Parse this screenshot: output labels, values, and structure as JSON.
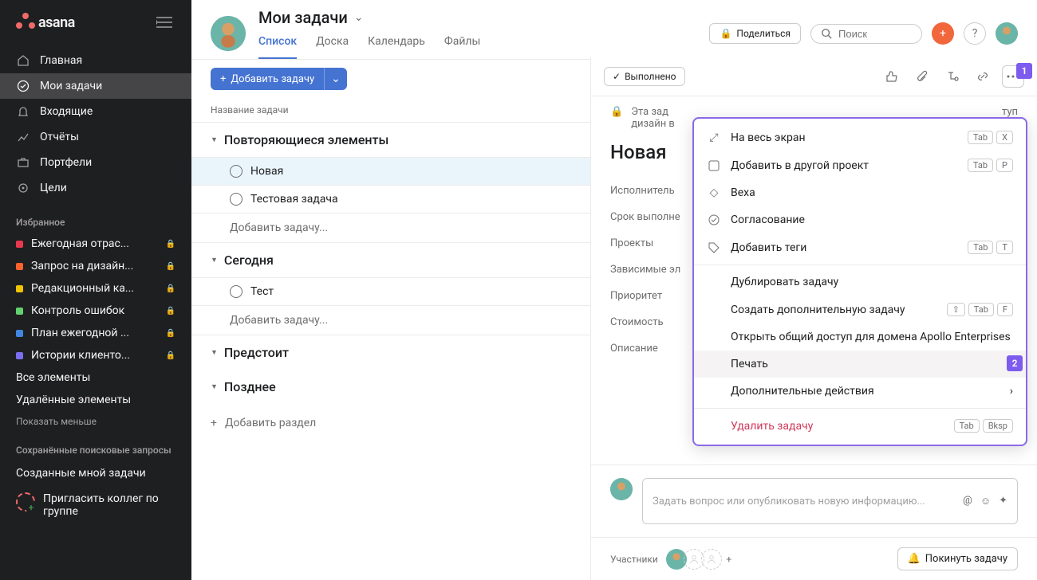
{
  "brand": "asana",
  "sidebar": {
    "nav": [
      {
        "label": "Главная",
        "name": "nav-home"
      },
      {
        "label": "Мои задачи",
        "name": "nav-my-tasks",
        "active": true
      },
      {
        "label": "Входящие",
        "name": "nav-inbox"
      },
      {
        "label": "Отчёты",
        "name": "nav-reports"
      },
      {
        "label": "Портфели",
        "name": "nav-portfolios"
      },
      {
        "label": "Цели",
        "name": "nav-goals"
      }
    ],
    "favorites_head": "Избранное",
    "favorites": [
      {
        "label": "Ежегодная отрас...",
        "color": "#e8384f",
        "locked": true
      },
      {
        "label": "Запрос на дизайн...",
        "color": "#fd612c",
        "locked": true
      },
      {
        "label": "Редакционный ка...",
        "color": "#eec300",
        "locked": true
      },
      {
        "label": "Контроль ошибок",
        "color": "#62d26f",
        "locked": true
      },
      {
        "label": "План ежегодной ...",
        "color": "#4186e0",
        "locked": true
      },
      {
        "label": "Истории клиенто...",
        "color": "#7a6ff0",
        "locked": true
      }
    ],
    "all_items": "Все элементы",
    "deleted_items": "Удалённые элементы",
    "show_less": "Показать меньше",
    "saved_head": "Сохранённые поисковые запросы",
    "created_by_me": "Созданные мной задачи",
    "invite": "Пригласить коллег по группе"
  },
  "header": {
    "title": "Мои задачи",
    "tabs": [
      {
        "label": "Список",
        "active": true
      },
      {
        "label": "Доска"
      },
      {
        "label": "Календарь"
      },
      {
        "label": "Файлы"
      }
    ],
    "share": "Поделиться",
    "search_placeholder": "Поиск"
  },
  "toolbar": {
    "add_task": "Добавить задачу"
  },
  "list": {
    "column_head": "Название задачи",
    "sections": [
      {
        "title": "Повторяющиеся элементы",
        "tasks": [
          {
            "label": "Новая",
            "selected": true
          },
          {
            "label": "Тестовая задача"
          }
        ],
        "add": "Добавить задачу..."
      },
      {
        "title": "Сегодня",
        "tasks": [
          {
            "label": "Тест"
          }
        ],
        "add": "Добавить задачу..."
      },
      {
        "title": "Предстоит",
        "tasks": []
      },
      {
        "title": "Позднее",
        "tasks": []
      }
    ],
    "add_section": "Добавить раздел"
  },
  "detail": {
    "done": "Выполнено",
    "privacy_line1": "Эта зад",
    "privacy_line2": "дизайн в",
    "privacy_tail": "туп",
    "title": "Новая",
    "fields": [
      {
        "label": "Исполнитель"
      },
      {
        "label": "Срок выполне"
      },
      {
        "label": "Проекты"
      },
      {
        "label": "Зависимые эл"
      },
      {
        "label": "Приоритет"
      },
      {
        "label": "Стоимость"
      },
      {
        "label": "Описание"
      }
    ],
    "comment_placeholder": "Задать вопрос или опубликовать новую информацию...",
    "followers_label": "Участники",
    "leave": "Покинуть задачу"
  },
  "menu": {
    "items": [
      {
        "icon": "expand",
        "label": "На весь экран",
        "keys": [
          "Tab",
          "X"
        ]
      },
      {
        "icon": "project",
        "label": "Добавить в другой проект",
        "keys": [
          "Tab",
          "P"
        ]
      },
      {
        "icon": "milestone",
        "label": "Веха"
      },
      {
        "icon": "approval",
        "label": "Согласование"
      },
      {
        "icon": "tag",
        "label": "Добавить теги",
        "keys": [
          "Tab",
          "T"
        ]
      },
      {
        "sep": true
      },
      {
        "label": "Дублировать задачу"
      },
      {
        "label": "Создать дополнительную задачу",
        "keys": [
          "⇧",
          "Tab",
          "F"
        ]
      },
      {
        "label": "Открыть общий доступ для домена Apollo Enterprises"
      },
      {
        "label": "Печать",
        "hover": true
      },
      {
        "label": "Дополнительные действия",
        "submenu": true
      },
      {
        "sep": true
      },
      {
        "label": "Удалить задачу",
        "danger": true,
        "keys": [
          "Tab",
          "Bksp"
        ]
      }
    ]
  },
  "callouts": {
    "one": "1",
    "two": "2"
  }
}
